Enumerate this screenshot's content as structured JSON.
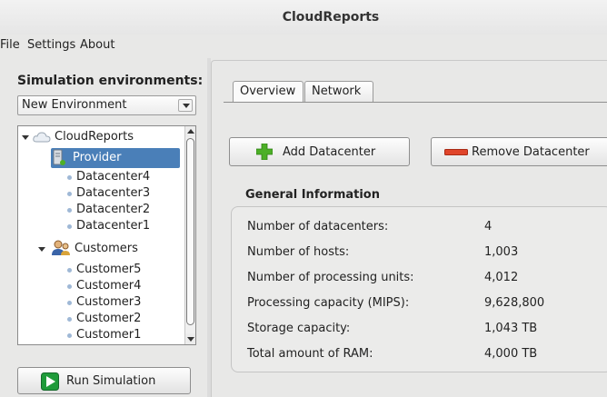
{
  "window": {
    "title": "CloudReports"
  },
  "menu": [
    "File",
    "Settings",
    "About"
  ],
  "left": {
    "env_label": "Simulation environments:",
    "env_select": "New Environment",
    "tree": {
      "root": "CloudReports",
      "provider": "Provider",
      "datacenters": [
        "Datacenter4",
        "Datacenter3",
        "Datacenter2",
        "Datacenter1"
      ],
      "customers_label": "Customers",
      "customers": [
        "Customer5",
        "Customer4",
        "Customer3",
        "Customer2",
        "Customer1"
      ]
    },
    "run_button": "Run Simulation"
  },
  "right": {
    "tabs": [
      "Overview",
      "Network"
    ],
    "active_tab": "Overview",
    "add_button": "Add Datacenter",
    "remove_button": "Remove Datacenter",
    "section_title": "General Information",
    "info": [
      {
        "label": "Number of datacenters:",
        "value": "4"
      },
      {
        "label": "Number of hosts:",
        "value": "1,003"
      },
      {
        "label": "Number of processing units:",
        "value": "4,012"
      },
      {
        "label": "Processing capacity (MIPS):",
        "value": "9,628,800"
      },
      {
        "label": "Storage capacity:",
        "value": "1,043 TB"
      },
      {
        "label": "Total amount of RAM:",
        "value": "4,000 TB"
      }
    ]
  },
  "colors": {
    "selection": "#4a7fb8",
    "add_icon": "#4caf27",
    "remove_icon": "#e0452b",
    "run_icon": "#1f9b3a"
  }
}
